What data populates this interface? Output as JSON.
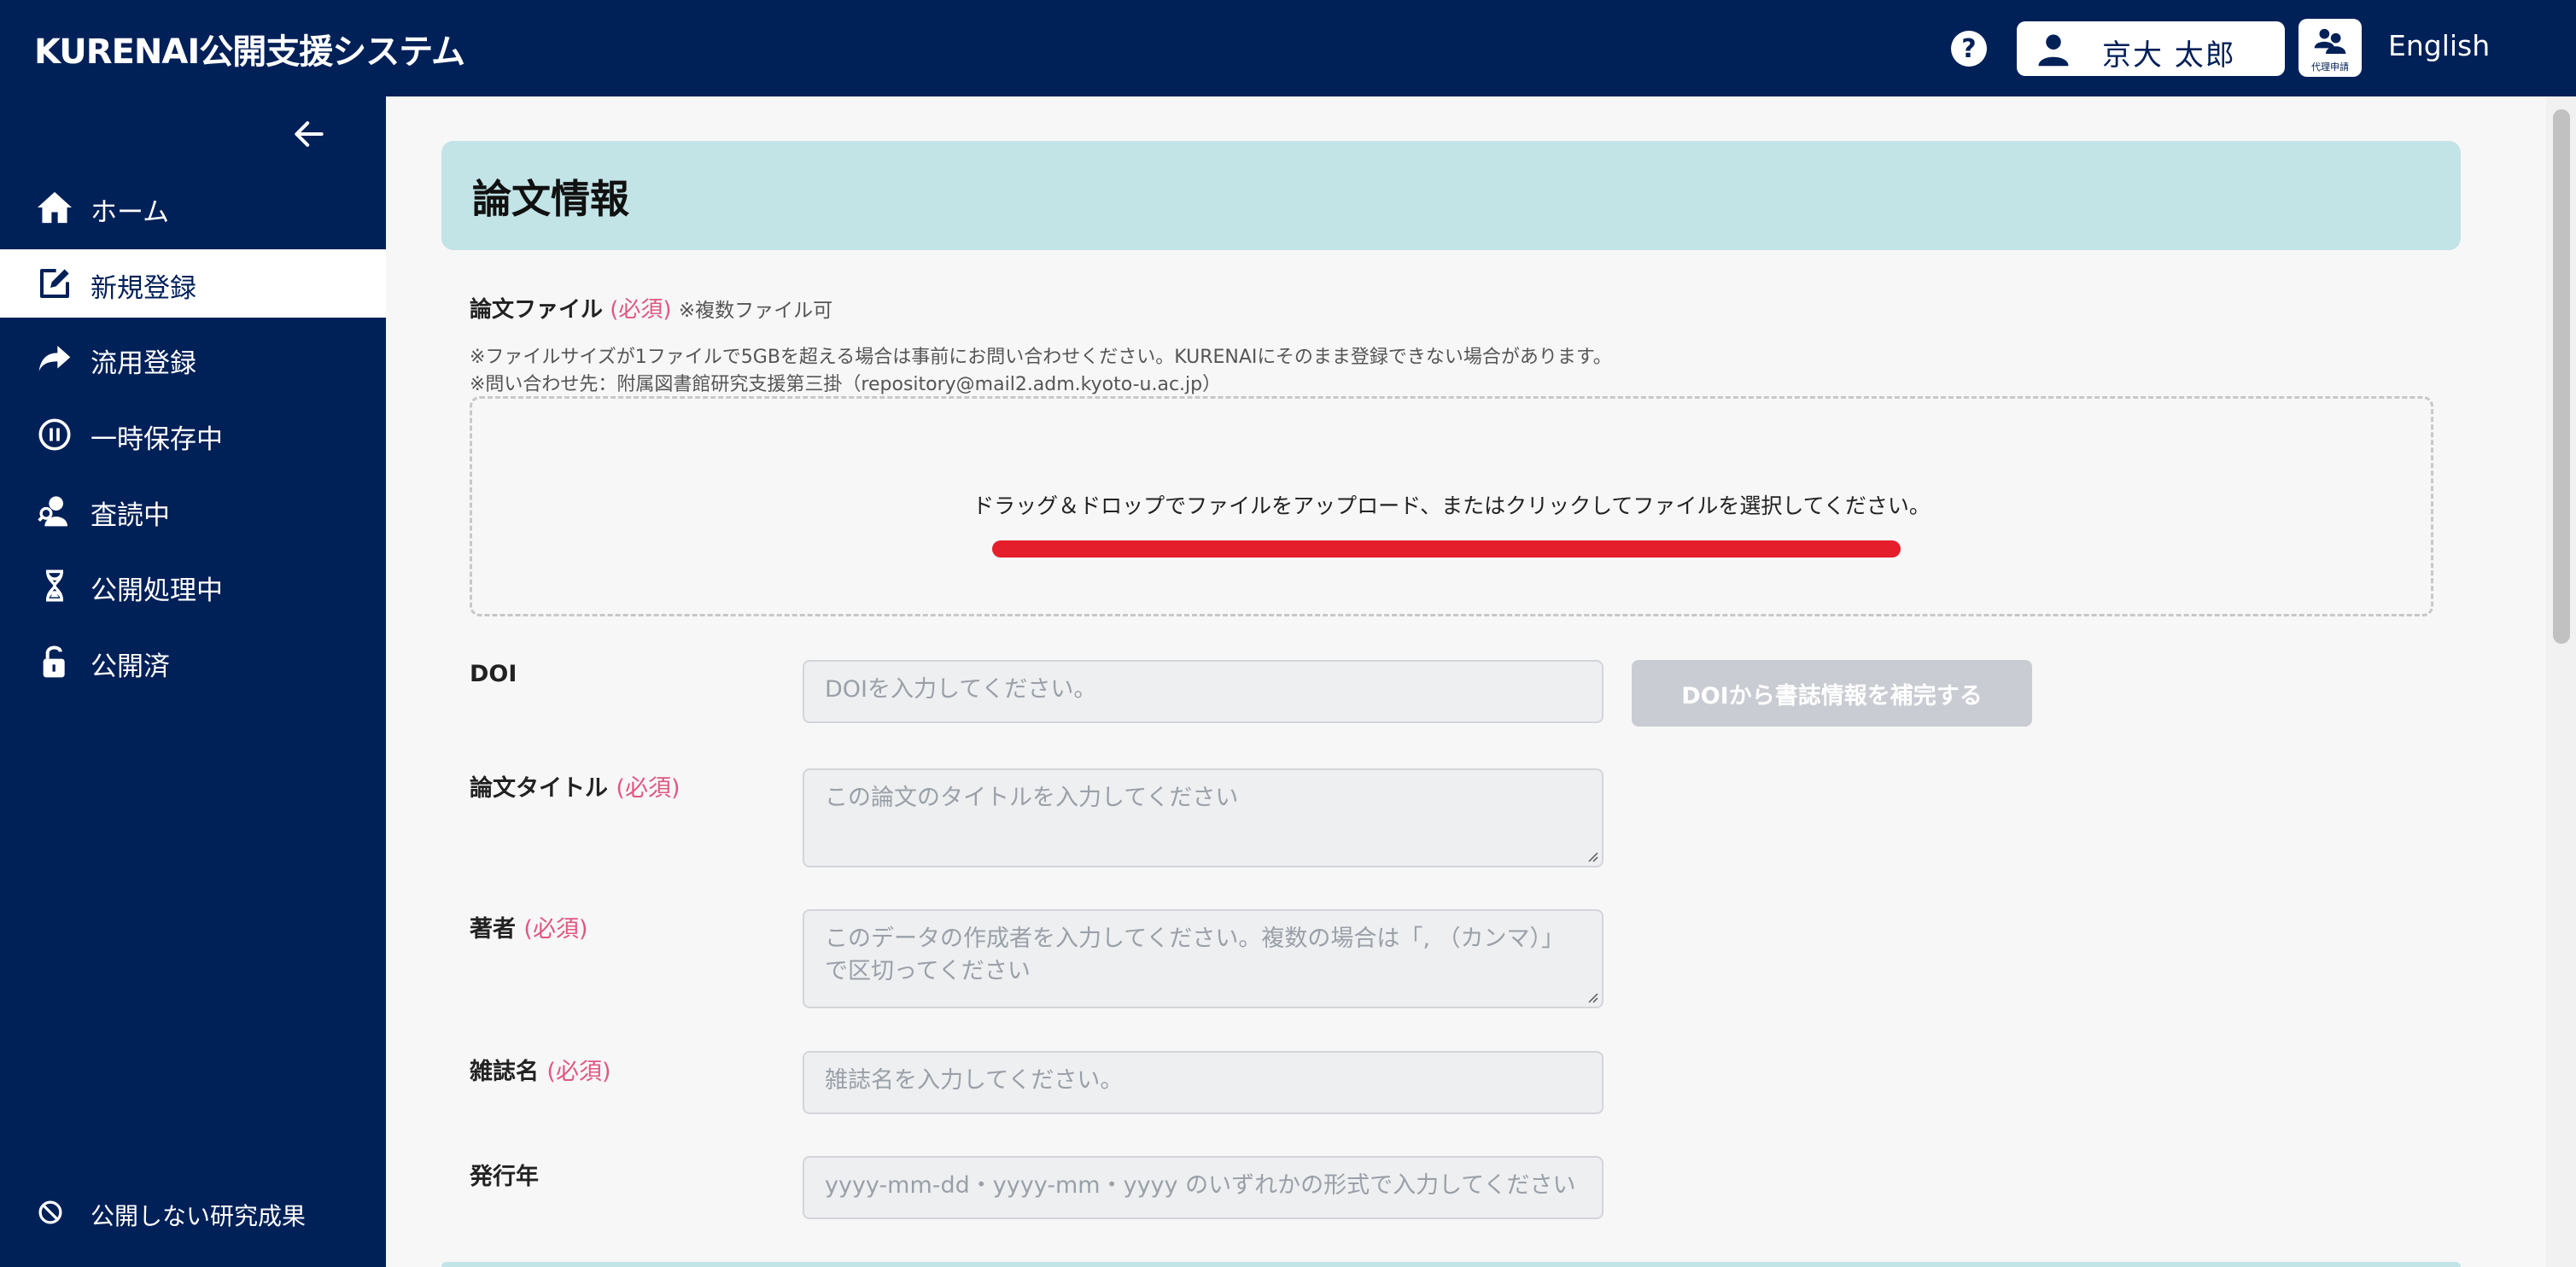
{
  "header": {
    "app_title": "KURENAI公開支援システム",
    "help_label": "?",
    "user_name": "京大 太郎",
    "proxy_label": "代理申請",
    "language_label": "English"
  },
  "sidebar": {
    "items": [
      {
        "label": "ホーム",
        "icon": "home-icon"
      },
      {
        "label": "新規登録",
        "icon": "edit-icon"
      },
      {
        "label": "流用登録",
        "icon": "share-arrow-icon"
      },
      {
        "label": "一時保存中",
        "icon": "pause-icon"
      },
      {
        "label": "査読中",
        "icon": "reviewer-icon"
      },
      {
        "label": "公開処理中",
        "icon": "hourglass-icon"
      },
      {
        "label": "公開済",
        "icon": "unlock-icon"
      }
    ],
    "active_index": 1,
    "bottom_item": {
      "label": "公開しない研究成果",
      "icon": "block-icon"
    }
  },
  "main": {
    "section_title": "論文情報",
    "file": {
      "label": "論文ファイル",
      "required": "(必須)",
      "hint": "※複数ファイル可",
      "note1": "※ファイルサイズが1ファイルで5GBを超える場合は事前にお問い合わせください。KURENAIにそのまま登録できない場合があります。",
      "note2": "※問い合わせ先：附属図書館研究支援第三掛（repository@mail2.adm.kyoto-u.ac.jp）",
      "dropzone_text": "ドラッグ＆ドロップでファイルをアップロード、またはクリックしてファイルを選択してください。"
    },
    "doi": {
      "label": "DOI",
      "placeholder": "DOIを入力してください。",
      "button_label": "DOIから書誌情報を補完する"
    },
    "title": {
      "label": "論文タイトル",
      "required": "(必須)",
      "placeholder": "この論文のタイトルを入力してください"
    },
    "author": {
      "label": "著者",
      "required": "(必須)",
      "placeholder": "このデータの作成者を入力してください。複数の場合は「, （カンマ）」で区切ってください"
    },
    "journal": {
      "label": "雑誌名",
      "required": "(必須)",
      "placeholder": "雑誌名を入力してください。"
    },
    "year": {
      "label": "発行年",
      "placeholder": "yyyy-mm-dd・yyyy-mm・yyyy のいずれかの形式で入力してください"
    }
  },
  "colors": {
    "navy": "#002058",
    "section_bg": "#c2e4e7",
    "required": "#e05780",
    "annotation_red": "#e41e2b"
  }
}
